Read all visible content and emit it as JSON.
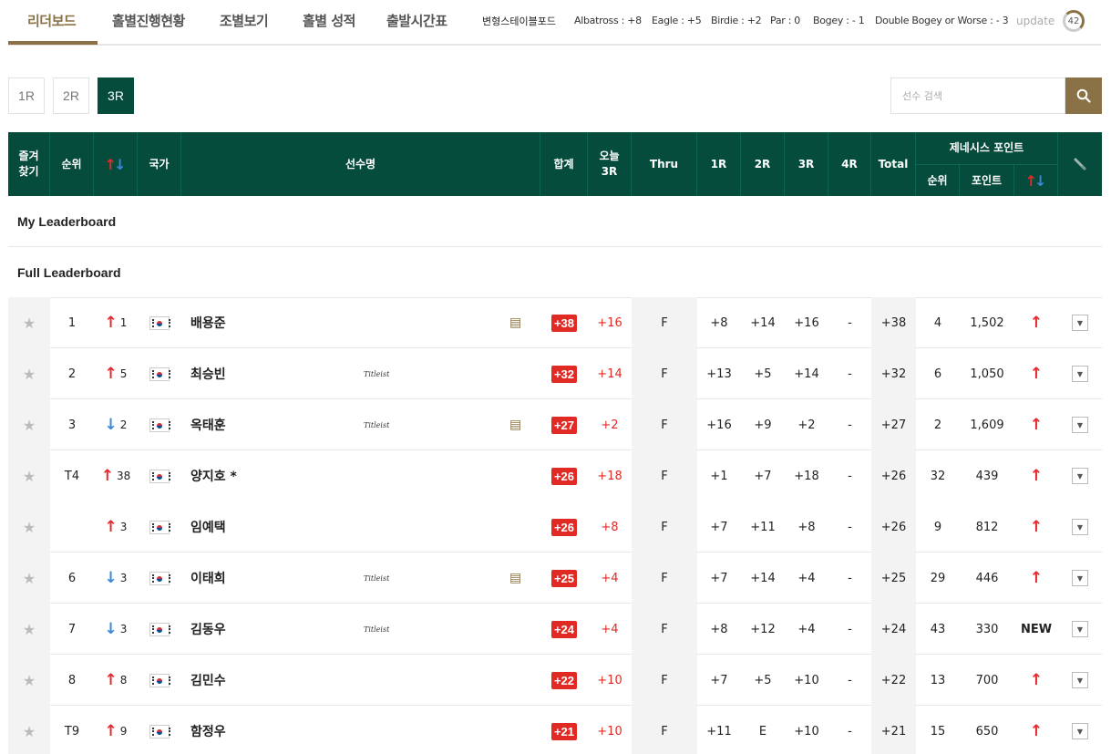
{
  "nav": {
    "tabs": [
      "리더보드",
      "홀별진행현황",
      "조별보기",
      "홀별 성적",
      "출발시간표"
    ],
    "legend_title": "변형스테이블포드",
    "legend": [
      "Albatross : +8",
      "Eagle : +5",
      "Birdie : +2",
      "Par : 0",
      "Bogey : - 1",
      "Double Bogey or Worse : - 3"
    ],
    "update_label": "update",
    "timer": "42"
  },
  "rounds": [
    "1R",
    "2R",
    "3R"
  ],
  "active_round": "3R",
  "search": {
    "placeholder": "선수 검색"
  },
  "headers": {
    "fav": "즐겨\n찾기",
    "rank": "순위",
    "country": "국가",
    "player": "선수명",
    "total_score": "합계",
    "today": "오늘\n3R",
    "thru": "Thru",
    "r1": "1R",
    "r2": "2R",
    "r3": "3R",
    "r4": "4R",
    "total": "Total",
    "genesis": "제네시스 포인트",
    "g_rank": "순위",
    "g_point": "포인트"
  },
  "sections": {
    "my": "My Leaderboard",
    "full": "Full Leaderboard"
  },
  "players": [
    {
      "rank": "1",
      "move_dir": "up",
      "move": "1",
      "name": "배용준",
      "sponsor": "",
      "doc": true,
      "total": "+38",
      "today": "+16",
      "thru": "F",
      "r1": "+8",
      "r2": "+14",
      "r3": "+16",
      "r4": "-",
      "tot": "+38",
      "grank": "4",
      "gpoint": "1,502",
      "gtrend": "up"
    },
    {
      "rank": "2",
      "move_dir": "up",
      "move": "5",
      "name": "최승빈",
      "sponsor": "Titleist",
      "doc": false,
      "total": "+32",
      "today": "+14",
      "thru": "F",
      "r1": "+13",
      "r2": "+5",
      "r3": "+14",
      "r4": "-",
      "tot": "+32",
      "grank": "6",
      "gpoint": "1,050",
      "gtrend": "up"
    },
    {
      "rank": "3",
      "move_dir": "down",
      "move": "2",
      "name": "옥태훈",
      "sponsor": "Titleist",
      "doc": true,
      "total": "+27",
      "today": "+2",
      "thru": "F",
      "r1": "+16",
      "r2": "+9",
      "r3": "+2",
      "r4": "-",
      "tot": "+27",
      "grank": "2",
      "gpoint": "1,609",
      "gtrend": "up"
    },
    {
      "rank": "T4",
      "move_dir": "up",
      "move": "38",
      "name": "양지호 *",
      "sponsor": "",
      "doc": false,
      "total": "+26",
      "today": "+18",
      "thru": "F",
      "r1": "+1",
      "r2": "+7",
      "r3": "+18",
      "r4": "-",
      "tot": "+26",
      "grank": "32",
      "gpoint": "439",
      "gtrend": "up",
      "noborder": true
    },
    {
      "rank": "",
      "move_dir": "up",
      "move": "3",
      "name": "임예택",
      "sponsor": "",
      "doc": false,
      "total": "+26",
      "today": "+8",
      "thru": "F",
      "r1": "+7",
      "r2": "+11",
      "r3": "+8",
      "r4": "-",
      "tot": "+26",
      "grank": "9",
      "gpoint": "812",
      "gtrend": "up"
    },
    {
      "rank": "6",
      "move_dir": "down",
      "move": "3",
      "name": "이태희",
      "sponsor": "Titleist",
      "doc": true,
      "total": "+25",
      "today": "+4",
      "thru": "F",
      "r1": "+7",
      "r2": "+14",
      "r3": "+4",
      "r4": "-",
      "tot": "+25",
      "grank": "29",
      "gpoint": "446",
      "gtrend": "up"
    },
    {
      "rank": "7",
      "move_dir": "down",
      "move": "3",
      "name": "김동우",
      "sponsor": "Titleist",
      "doc": false,
      "total": "+24",
      "today": "+4",
      "thru": "F",
      "r1": "+8",
      "r2": "+12",
      "r3": "+4",
      "r4": "-",
      "tot": "+24",
      "grank": "43",
      "gpoint": "330",
      "gtrend": "new",
      "gtrend_label": "NEW"
    },
    {
      "rank": "8",
      "move_dir": "up",
      "move": "8",
      "name": "김민수",
      "sponsor": "",
      "doc": false,
      "total": "+22",
      "today": "+10",
      "thru": "F",
      "r1": "+7",
      "r2": "+5",
      "r3": "+10",
      "r4": "-",
      "tot": "+22",
      "grank": "13",
      "gpoint": "700",
      "gtrend": "up"
    },
    {
      "rank": "T9",
      "move_dir": "up",
      "move": "9",
      "name": "함정우",
      "sponsor": "",
      "doc": false,
      "total": "+21",
      "today": "+10",
      "thru": "F",
      "r1": "+11",
      "r2": "E",
      "r3": "+10",
      "r4": "-",
      "tot": "+21",
      "grank": "15",
      "gpoint": "650",
      "gtrend": "up"
    }
  ],
  "colors": {
    "header_bg": "#064c3c",
    "gold": "#8a7246",
    "red": "#e22a24",
    "up": "#e8262b",
    "down": "#3a86d8"
  },
  "icons": {
    "fav": "star-icon",
    "move_up": "arrow-up-icon",
    "move_down": "arrow-down-icon",
    "doc": "article-icon",
    "search": "search-icon",
    "dropdown": "chevron-down-icon",
    "settings": "pin-icon"
  }
}
